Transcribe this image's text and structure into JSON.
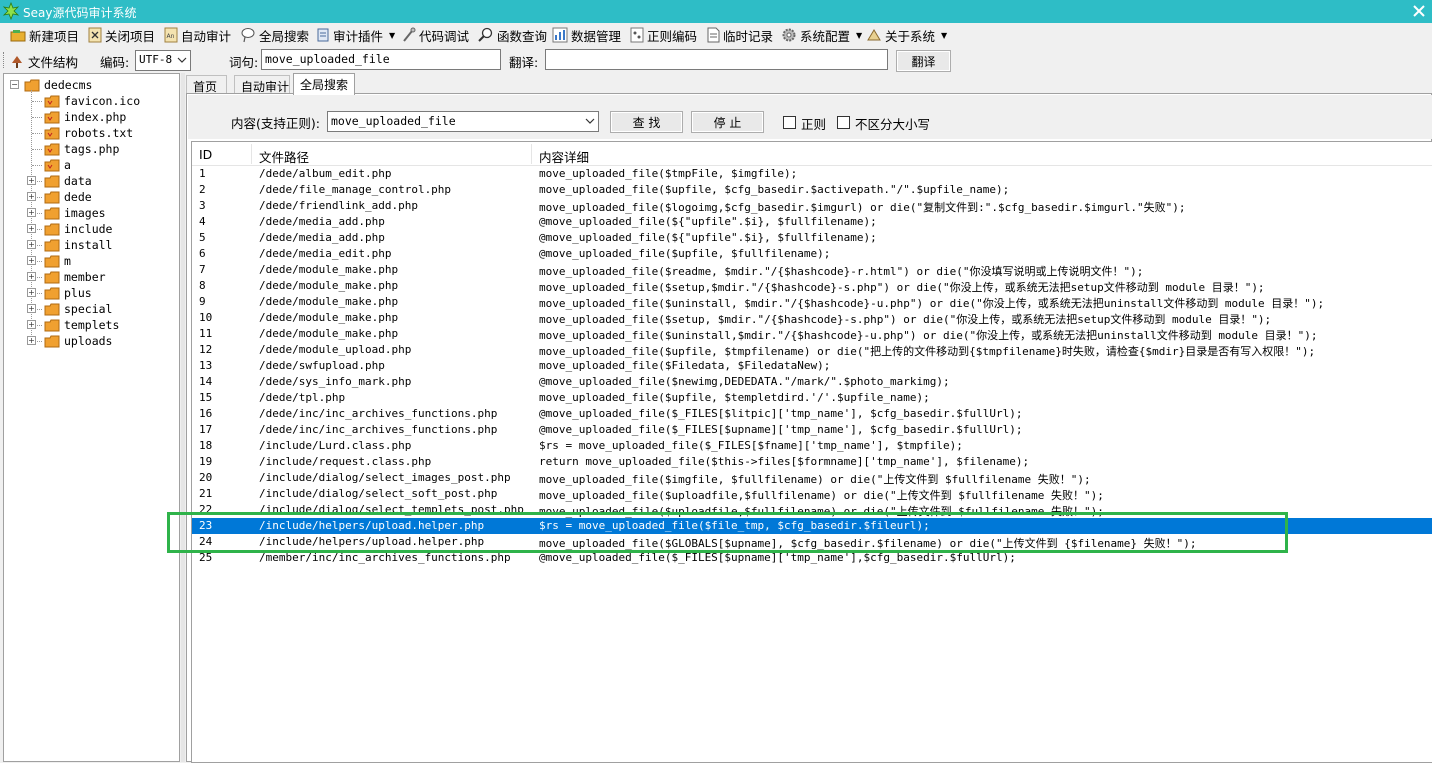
{
  "window": {
    "title": "Seay源代码审计系统"
  },
  "menu": [
    {
      "label": "新建项目",
      "icon": "new-project-icon",
      "dropdown": false
    },
    {
      "label": "关闭项目",
      "icon": "close-project-icon",
      "dropdown": false
    },
    {
      "label": "自动审计",
      "icon": "auto-audit-icon",
      "dropdown": false
    },
    {
      "label": "全局搜索",
      "icon": "global-search-icon",
      "dropdown": false
    },
    {
      "label": "审计插件",
      "icon": "plugin-icon",
      "dropdown": true
    },
    {
      "label": "代码调试",
      "icon": "debug-icon",
      "dropdown": false
    },
    {
      "label": "函数查询",
      "icon": "function-search-icon",
      "dropdown": false
    },
    {
      "label": "数据管理",
      "icon": "data-manage-icon",
      "dropdown": false
    },
    {
      "label": "正则编码",
      "icon": "regex-encode-icon",
      "dropdown": false
    },
    {
      "label": "临时记录",
      "icon": "notes-icon",
      "dropdown": false
    },
    {
      "label": "系统配置",
      "icon": "gear-icon",
      "dropdown": true
    },
    {
      "label": "关于系统",
      "icon": "about-icon",
      "dropdown": true
    }
  ],
  "toolbar": {
    "file_tree_label": "文件结构",
    "encoding_label": "编码:",
    "encoding_value": "UTF-8",
    "phrase_label": "词句:",
    "phrase_value": "move_uploaded_file",
    "translate_label": "翻译:",
    "translate_value": "",
    "translate_button": "翻译"
  },
  "tree": {
    "root": "dedecms",
    "files": [
      "favicon.ico",
      "index.php",
      "robots.txt",
      "tags.php",
      "a"
    ],
    "folders": [
      "data",
      "dede",
      "images",
      "include",
      "install",
      "m",
      "member",
      "plus",
      "special",
      "templets",
      "uploads"
    ]
  },
  "tabs": [
    {
      "label": "首页",
      "active": false
    },
    {
      "label": "自动审计",
      "active": false
    },
    {
      "label": "全局搜索",
      "active": true
    }
  ],
  "search": {
    "content_label": "内容(支持正则):",
    "content_value": "move_uploaded_file",
    "find_button": "查 找",
    "stop_button": "停 止",
    "regex_label": "正则",
    "regex_checked": false,
    "ignore_case_label": "不区分大小写",
    "ignore_case_checked": false
  },
  "results": {
    "columns": [
      "ID",
      "文件路径",
      "内容详细"
    ],
    "selected_id": "23",
    "rows": [
      {
        "id": "1",
        "path": "/dede/album_edit.php",
        "detail": "move_uploaded_file($tmpFile, $imgfile);"
      },
      {
        "id": "2",
        "path": "/dede/file_manage_control.php",
        "detail": "move_uploaded_file($upfile, $cfg_basedir.$activepath.\"/\".$upfile_name);"
      },
      {
        "id": "3",
        "path": "/dede/friendlink_add.php",
        "detail": "move_uploaded_file($logoimg,$cfg_basedir.$imgurl) or die(\"复制文件到:\".$cfg_basedir.$imgurl.\"失败\");"
      },
      {
        "id": "4",
        "path": "/dede/media_add.php",
        "detail": "@move_uploaded_file(${\"upfile\".$i}, $fullfilename);"
      },
      {
        "id": "5",
        "path": "/dede/media_add.php",
        "detail": "@move_uploaded_file(${\"upfile\".$i}, $fullfilename);"
      },
      {
        "id": "6",
        "path": "/dede/media_edit.php",
        "detail": "@move_uploaded_file($upfile, $fullfilename);"
      },
      {
        "id": "7",
        "path": "/dede/module_make.php",
        "detail": "move_uploaded_file($readme, $mdir.\"/{$hashcode}-r.html\") or die(\"你没填写说明或上传说明文件！\");"
      },
      {
        "id": "8",
        "path": "/dede/module_make.php",
        "detail": "move_uploaded_file($setup,$mdir.\"/{$hashcode}-s.php\") or die(\"你没上传，或系统无法把setup文件移动到 module 目录！\");"
      },
      {
        "id": "9",
        "path": "/dede/module_make.php",
        "detail": "move_uploaded_file($uninstall, $mdir.\"/{$hashcode}-u.php\") or die(\"你没上传，或系统无法把uninstall文件移动到 module 目录！\");"
      },
      {
        "id": "10",
        "path": "/dede/module_make.php",
        "detail": "move_uploaded_file($setup, $mdir.\"/{$hashcode}-s.php\") or die(\"你没上传，或系统无法把setup文件移动到 module 目录！\");"
      },
      {
        "id": "11",
        "path": "/dede/module_make.php",
        "detail": "move_uploaded_file($uninstall,$mdir.\"/{$hashcode}-u.php\") or die(\"你没上传，或系统无法把uninstall文件移动到 module 目录！\");"
      },
      {
        "id": "12",
        "path": "/dede/module_upload.php",
        "detail": "move_uploaded_file($upfile, $tmpfilename) or die(\"把上传的文件移动到{$tmpfilename}时失败，请检查{$mdir}目录是否有写入权限！\");"
      },
      {
        "id": "13",
        "path": "/dede/swfupload.php",
        "detail": "move_uploaded_file($Filedata, $FiledataNew);"
      },
      {
        "id": "14",
        "path": "/dede/sys_info_mark.php",
        "detail": "@move_uploaded_file($newimg,DEDEDATA.\"/mark/\".$photo_markimg);"
      },
      {
        "id": "15",
        "path": "/dede/tpl.php",
        "detail": "move_uploaded_file($upfile, $templetdird.'/'.$upfile_name);"
      },
      {
        "id": "16",
        "path": "/dede/inc/inc_archives_functions.php",
        "detail": "@move_uploaded_file($_FILES[$litpic]['tmp_name'], $cfg_basedir.$fullUrl);"
      },
      {
        "id": "17",
        "path": "/dede/inc/inc_archives_functions.php",
        "detail": "@move_uploaded_file($_FILES[$upname]['tmp_name'], $cfg_basedir.$fullUrl);"
      },
      {
        "id": "18",
        "path": "/include/Lurd.class.php",
        "detail": "$rs = move_uploaded_file($_FILES[$fname]['tmp_name'], $tmpfile);"
      },
      {
        "id": "19",
        "path": "/include/request.class.php",
        "detail": "return move_uploaded_file($this->files[$formname]['tmp_name'], $filename);"
      },
      {
        "id": "20",
        "path": "/include/dialog/select_images_post.php",
        "detail": "move_uploaded_file($imgfile, $fullfilename) or die(\"上传文件到 $fullfilename 失败！\");"
      },
      {
        "id": "21",
        "path": "/include/dialog/select_soft_post.php",
        "detail": "move_uploaded_file($uploadfile,$fullfilename) or die(\"上传文件到 $fullfilename 失败！\");"
      },
      {
        "id": "22",
        "path": "/include/dialog/select_templets_post.php",
        "detail": "move_uploaded_file($uploadfile,$fullfilename) or die(\"上传文件到 $fullfilename 失败！\");"
      },
      {
        "id": "23",
        "path": "/include/helpers/upload.helper.php",
        "detail": "$rs = move_uploaded_file($file_tmp, $cfg_basedir.$fileurl);"
      },
      {
        "id": "24",
        "path": "/include/helpers/upload.helper.php",
        "detail": "move_uploaded_file($GLOBALS[$upname], $cfg_basedir.$filename) or die(\"上传文件到 {$filename} 失败！\");"
      },
      {
        "id": "25",
        "path": "/member/inc/inc_archives_functions.php",
        "detail": "@move_uploaded_file($_FILES[$upname]['tmp_name'],$cfg_basedir.$fullUrl);"
      }
    ]
  },
  "colors": {
    "titlebar": "#2ebdc6",
    "selection": "#0078d7",
    "highlight_box": "#2fb34a",
    "folder": "#f0a030"
  }
}
